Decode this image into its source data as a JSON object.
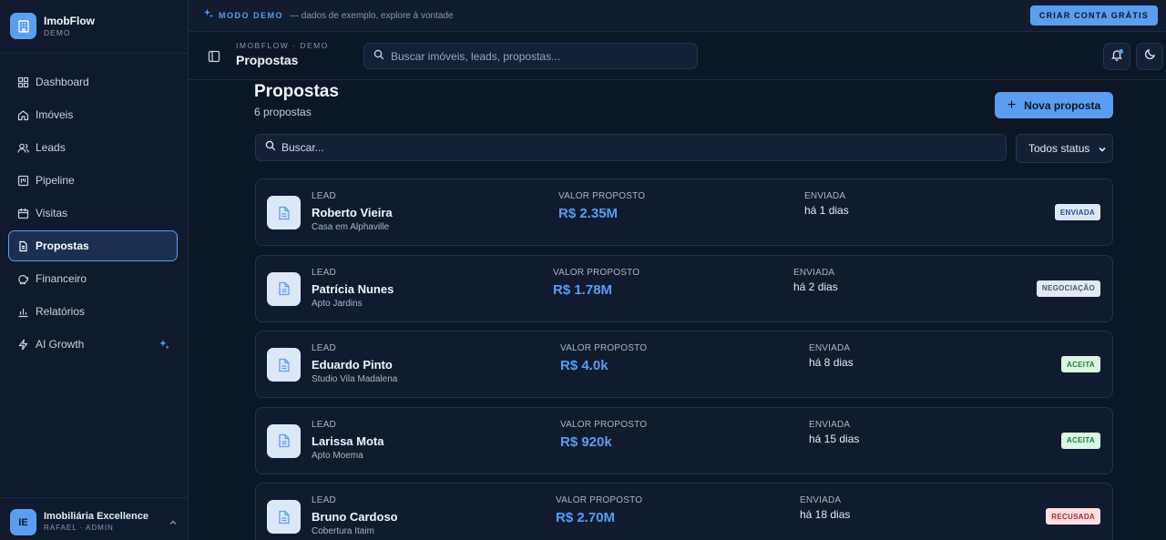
{
  "brand": {
    "name": "ImobFlow",
    "sub": "DEMO"
  },
  "nav": [
    {
      "key": "dashboard",
      "label": "Dashboard",
      "icon": "grid-icon"
    },
    {
      "key": "imoveis",
      "label": "Imóveis",
      "icon": "home-icon"
    },
    {
      "key": "leads",
      "label": "Leads",
      "icon": "users-icon"
    },
    {
      "key": "pipeline",
      "label": "Pipeline",
      "icon": "kanban-icon"
    },
    {
      "key": "visitas",
      "label": "Visitas",
      "icon": "calendar-icon"
    },
    {
      "key": "propostas",
      "label": "Propostas",
      "icon": "file-icon",
      "active": true
    },
    {
      "key": "financeiro",
      "label": "Financeiro",
      "icon": "piggy-bank-icon"
    },
    {
      "key": "relatorios",
      "label": "Relatórios",
      "icon": "bar-chart-icon"
    },
    {
      "key": "ai-growth",
      "label": "AI Growth",
      "icon": "bolt-icon",
      "extra_icon": "sparkle-icon"
    }
  ],
  "user": {
    "initials": "IE",
    "name": "Imobiliária Excellence",
    "role": "RAFAEL · ADMIN"
  },
  "banner": {
    "tag": "MODO DEMO",
    "desc": "— dados de exemplo, explore à vontade",
    "cta": "CRIAR CONTA GRÁTIS"
  },
  "header": {
    "crumb": "IMOBFLOW · DEMO",
    "title": "Propostas",
    "search_placeholder": "Buscar imóveis, leads, propostas..."
  },
  "page": {
    "title": "Propostas",
    "count": "6 propostas",
    "new_button": "Nova proposta",
    "search_placeholder": "Buscar...",
    "status_filter": "Todos status"
  },
  "labels": {
    "lead": "LEAD",
    "valor": "VALOR PROPOSTO",
    "enviada": "ENVIADA"
  },
  "status_colors": {
    "ENVIADA": {
      "bg": "#dde8f7",
      "fg": "#1f4f95"
    },
    "NEGOCIAÇÃO": {
      "bg": "#e3e9f0",
      "fg": "#4a5a70"
    },
    "ACEITA": {
      "bg": "#d9f7e2",
      "fg": "#1d7a3c"
    },
    "RECUSADA": {
      "bg": "#fde0e0",
      "fg": "#b3262d"
    }
  },
  "proposals": [
    {
      "name": "Roberto Vieira",
      "property": "Casa em Alphaville",
      "value": "R$ 2.35M",
      "sent": "há 1 dias",
      "status": "ENVIADA"
    },
    {
      "name": "Patrícia Nunes",
      "property": "Apto Jardins",
      "value": "R$ 1.78M",
      "sent": "há 2 dias",
      "status": "NEGOCIAÇÃO"
    },
    {
      "name": "Eduardo Pinto",
      "property": "Studio Vila Madalena",
      "value": "R$ 4.0k",
      "sent": "há 8 dias",
      "status": "ACEITA"
    },
    {
      "name": "Larissa Mota",
      "property": "Apto Moema",
      "value": "R$ 920k",
      "sent": "há 15 dias",
      "status": "ACEITA"
    },
    {
      "name": "Bruno Cardoso",
      "property": "Cobertura Itaim",
      "value": "R$ 2.70M",
      "sent": "há 18 dias",
      "status": "RECUSADA"
    }
  ]
}
